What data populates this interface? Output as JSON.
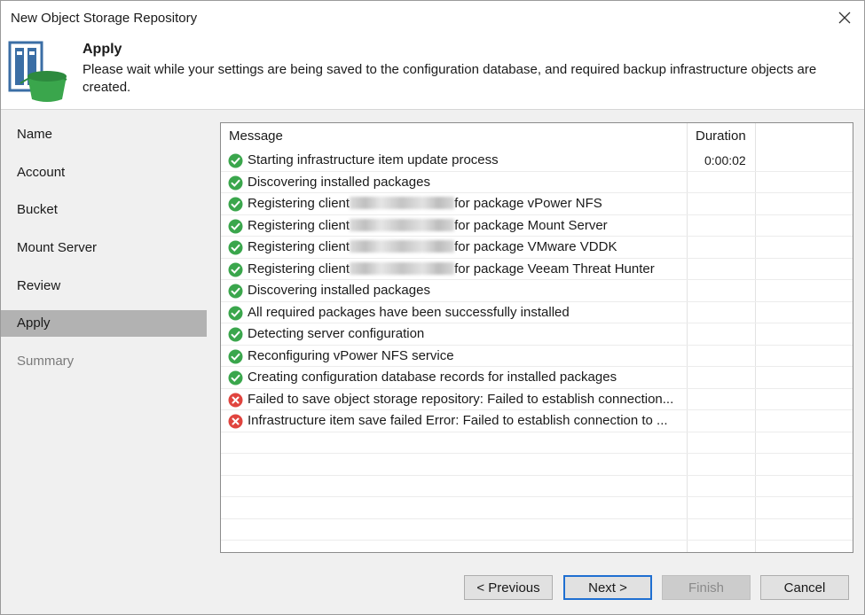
{
  "window": {
    "title": "New Object Storage Repository"
  },
  "header": {
    "title": "Apply",
    "description": "Please wait while your settings are being saved to the configuration database, and required backup infrastructure objects are created."
  },
  "sidebar": {
    "items": [
      {
        "label": "Name",
        "state": "normal"
      },
      {
        "label": "Account",
        "state": "normal"
      },
      {
        "label": "Bucket",
        "state": "normal"
      },
      {
        "label": "Mount Server",
        "state": "normal"
      },
      {
        "label": "Review",
        "state": "normal"
      },
      {
        "label": "Apply",
        "state": "active"
      },
      {
        "label": "Summary",
        "state": "disabled"
      }
    ]
  },
  "table": {
    "columns": {
      "message": "Message",
      "duration": "Duration"
    },
    "rows": [
      {
        "status": "success",
        "message": "Starting infrastructure item update process",
        "duration": "0:00:02"
      },
      {
        "status": "success",
        "message": "Discovering installed packages",
        "duration": ""
      },
      {
        "status": "success",
        "prefix": "Registering client",
        "suffix": "for package vPower NFS",
        "redacted": true,
        "duration": ""
      },
      {
        "status": "success",
        "prefix": "Registering client",
        "suffix": "for package Mount Server",
        "redacted": true,
        "duration": ""
      },
      {
        "status": "success",
        "prefix": "Registering client",
        "suffix": "for package VMware VDDK",
        "redacted": true,
        "duration": ""
      },
      {
        "status": "success",
        "prefix": "Registering client",
        "suffix": "for package Veeam Threat Hunter",
        "redacted": true,
        "duration": ""
      },
      {
        "status": "success",
        "message": "Discovering installed packages",
        "duration": ""
      },
      {
        "status": "success",
        "message": "All required packages have been successfully installed",
        "duration": ""
      },
      {
        "status": "success",
        "message": "Detecting server configuration",
        "duration": ""
      },
      {
        "status": "success",
        "message": "Reconfiguring vPower NFS service",
        "duration": ""
      },
      {
        "status": "success",
        "message": "Creating configuration database records for installed packages",
        "duration": ""
      },
      {
        "status": "error",
        "message": "Failed to save object storage repository: Failed to establish connection...",
        "duration": ""
      },
      {
        "status": "error",
        "message": "Infrastructure item save failed Error: Failed to establish connection to ...",
        "duration": ""
      }
    ]
  },
  "buttons": {
    "previous": "< Previous",
    "next": "Next >",
    "finish": "Finish",
    "cancel": "Cancel"
  },
  "colors": {
    "success": "#3aa64c",
    "error": "#e0443e",
    "active_nav": "#b2b2b2",
    "default_button_border": "#1f6fd1"
  }
}
